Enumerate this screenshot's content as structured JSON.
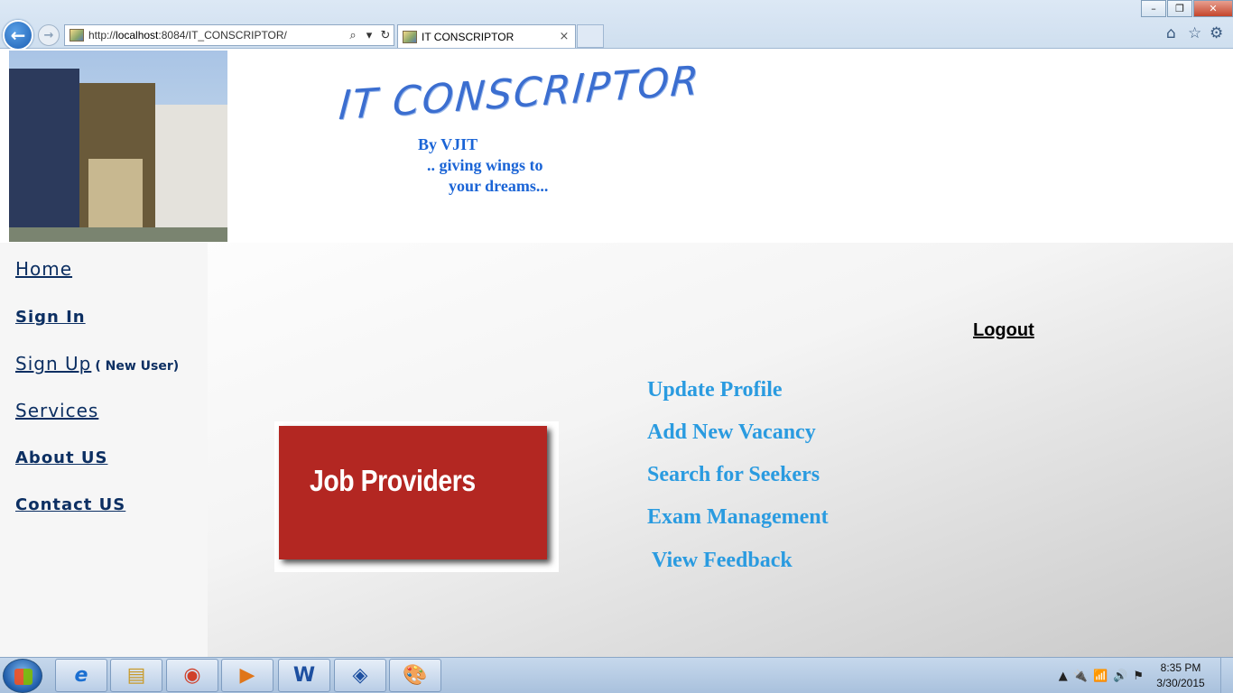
{
  "browser": {
    "back": "←",
    "forward": "→",
    "url_prefix": "http://",
    "url_host": "localhost",
    "url_rest": ":8084/IT_CONSCRIPTOR/",
    "search_icon": "⌕",
    "dropdown_icon": "▾",
    "refresh_icon": "↻",
    "tab_title": "IT CONSCRIPTOR",
    "tab_close": "×",
    "minimize": "–",
    "restore": "❐",
    "close": "✕",
    "home_icon": "⌂",
    "favorites_icon": "☆",
    "tools_icon": "⚙"
  },
  "header": {
    "logo": "IT CONSCRIPTOR",
    "by": "By VJIT",
    "tagline_1": ".. giving wings to",
    "tagline_2": "your dreams..."
  },
  "sidebar": {
    "items": [
      {
        "label": "Home"
      },
      {
        "label": "Sign In"
      },
      {
        "label": "Sign Up",
        "note": "( New User)"
      },
      {
        "label": "Services"
      },
      {
        "label": "About US"
      },
      {
        "label": "Contact US"
      }
    ]
  },
  "main": {
    "logout": "Logout",
    "banner": "Job Providers",
    "actions": [
      "Update Profile",
      "Add New Vacancy",
      "Search for Seekers",
      "Exam Management",
      "View Feedback"
    ]
  },
  "taskbar": {
    "apps": [
      "e",
      "▤",
      "◉",
      "▶",
      "W",
      "◈",
      "🎨"
    ],
    "tray_icons": [
      "▲",
      "🔌",
      "📶",
      "🔊",
      "⚑"
    ],
    "time": "8:35 PM",
    "date": "3/30/2015"
  },
  "colors": {
    "nav_text": "#0c2f62",
    "action_link": "#2a9be0",
    "banner_bg": "#b32722",
    "tagline": "#1a64d6"
  }
}
